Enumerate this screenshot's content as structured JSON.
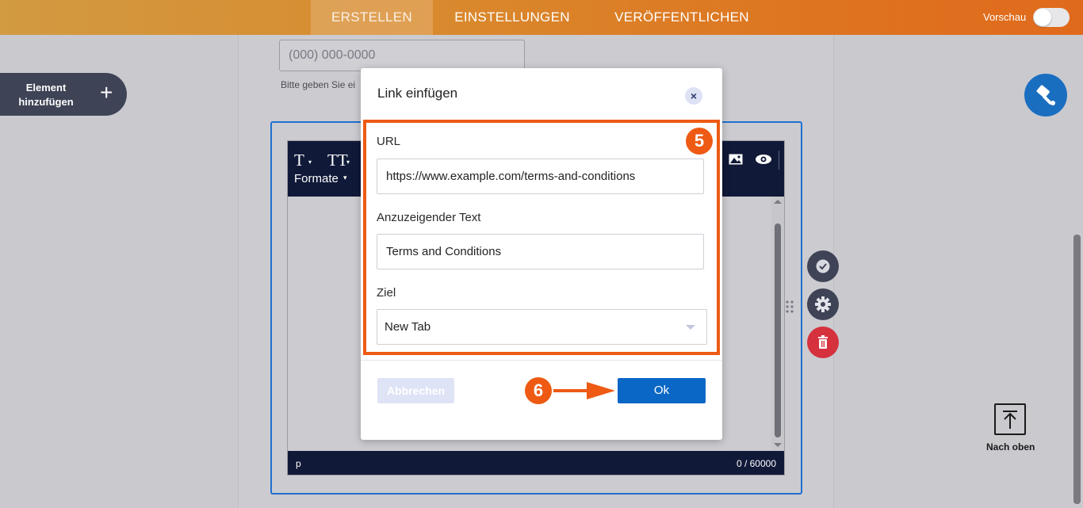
{
  "topbar": {
    "tabs": [
      {
        "label": "ERSTELLEN",
        "active": true
      },
      {
        "label": "EINSTELLUNGEN",
        "active": false
      },
      {
        "label": "VERÖFFENTLICHEN",
        "active": false
      }
    ],
    "preview_label": "Vorschau",
    "preview_toggle_on": false
  },
  "sidebar": {
    "add_element_line1": "Element",
    "add_element_line2": "hinzufügen",
    "add_icon": "plus-icon"
  },
  "form": {
    "phone_placeholder": "(000) 000-0000",
    "phone_hint": "Bitte geben Sie ei"
  },
  "editor": {
    "toolbar": {
      "font_icon": "T",
      "size_icon": "TT",
      "formats_label": "Formate",
      "image_icon": "image-icon",
      "preview_icon": "eye-icon"
    },
    "footer_path": "p",
    "char_count": "0 / 60000"
  },
  "block_actions": [
    "check-icon",
    "gear-icon",
    "trash-icon"
  ],
  "back_to_top": {
    "label": "Nach oben",
    "icon": "arrow-up-icon"
  },
  "modal": {
    "title": "Link einfügen",
    "close_icon": "×",
    "url_label": "URL",
    "url_value": "https://www.example.com/terms-and-conditions",
    "text_label": "Anzuzeigender Text",
    "text_value": "Terms and Conditions",
    "target_label": "Ziel",
    "target_value": "New Tab",
    "cancel_label": "Abbrechen",
    "ok_label": "Ok"
  },
  "annotations": {
    "step_fields": "5",
    "step_ok": "6",
    "accent_color": "#ee5a14"
  },
  "colors": {
    "primary_blue": "#0b67c6",
    "toolbar_navy": "#101938",
    "danger_red": "#d5323d"
  }
}
